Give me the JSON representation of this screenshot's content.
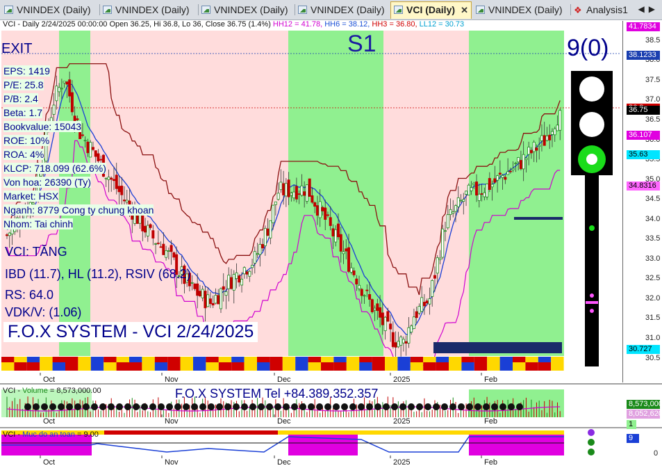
{
  "tabs": [
    {
      "label": "VNINDEX (Daily)",
      "active": false
    },
    {
      "label": "VNINDEX (Daily)",
      "active": false
    },
    {
      "label": "VNINDEX (Daily)",
      "active": false
    },
    {
      "label": "VNINDEX (Daily)",
      "active": false
    },
    {
      "label": "VCI (Daily)",
      "active": true,
      "close": "✕"
    },
    {
      "label": "VNINDEX (Daily)",
      "active": false
    },
    {
      "label": "Analysis1",
      "active": false
    }
  ],
  "header": {
    "main": "VCI - Daily 2/24/2025 00:00:00 Open 36.25, Hi 36.8, Lo 36, Close 36.75 (1.4%)",
    "hh12": "HH12 = 41.78,",
    "hh6": "HH6 = 38.12,",
    "hh3": "HH3 = 36.80,",
    "ll12": "LL12 = 30.73"
  },
  "signals": {
    "exit": "EXIT",
    "phase": "S1",
    "score": "9(0)"
  },
  "fundamentals": [
    "EPS: 1419",
    "P/E: 25.8",
    "P/B: 2.4",
    "Beta: 1.7",
    "Bookvalue: 15043",
    "ROE: 10%",
    "ROA: 4%",
    "KLCP: 718.099 (62.6%)",
    "Von hoa: 26390 (Ty)",
    "Market: HSX",
    "Nganh: 8779 Cong ty chung khoan",
    "Nhom: Tai chinh"
  ],
  "assessment": {
    "trend": "VCI: TĂNG",
    "ratings": "IBD (11.7), HL (11.2), RSIV (68.2)",
    "rs": "RS: 64.0",
    "vdk": "VDK/V:  (1.06)"
  },
  "system_title": "F.O.X SYSTEM - VCI 2/24/2025",
  "system_phone": "F.O.X SYSTEM Tel +84.389.352.357",
  "price_axis": {
    "ticks": [
      "38.5",
      "38.0",
      "37.5",
      "37.0",
      "36.5",
      "36.0",
      "35.5",
      "35.0",
      "34.5",
      "34.0",
      "33.5",
      "33.0",
      "32.5",
      "32.0",
      "31.5",
      "31.0",
      "30.5"
    ],
    "tags": [
      {
        "text": "41.7834",
        "bg": "#e000e0",
        "fg": "#ffffff",
        "value": 41.7834
      },
      {
        "text": "38.1233",
        "bg": "#1a3fb0",
        "fg": "#ffffff",
        "value": 38.1233
      },
      {
        "text": "36.8",
        "bg": "#d00000",
        "fg": "#ffffff",
        "value": 36.8
      },
      {
        "text": "36.75",
        "bg": "#000000",
        "fg": "#ffffff",
        "value": 36.75
      },
      {
        "text": "36.107",
        "bg": "#e000e0",
        "fg": "#ffffff",
        "value": 36.107
      },
      {
        "text": "35.63",
        "bg": "#00e5ff",
        "fg": "#000000",
        "value": 35.63
      },
      {
        "text": "34.8316",
        "bg": "#ff66ff",
        "fg": "#000000",
        "value": 34.8316
      },
      {
        "text": "30.727",
        "bg": "#00e5ff",
        "fg": "#000000",
        "value": 30.727
      }
    ]
  },
  "months": [
    "Oct",
    "Nov",
    "Dec",
    "2025",
    "Feb"
  ],
  "volume": {
    "label_prefix": "VCI - ",
    "label_name": "Volume",
    "label_value": " = 8,573,000.00",
    "tag1": "8,573,000",
    "tag2": "8,052,620",
    "tag3": "1"
  },
  "safety": {
    "label_prefix": "VCI - ",
    "label_name": "Muc do an toan",
    "label_value": " = 9.00",
    "tag": "9",
    "axis0": "0"
  },
  "colors": {
    "green_zone": "#90f090",
    "pink_zone": "#ffdcdc",
    "candle_up": "#1a8a1a",
    "candle_down": "#c00000",
    "hh_line": "#8b1010",
    "blue_line": "#1a3fd6",
    "magenta_line": "#d000d0",
    "cyan_fill": "#00e5ff"
  },
  "chart_data": {
    "type": "candlestick",
    "title": "VCI - Daily",
    "ylim": [
      30.3,
      38.9
    ],
    "last_close": 36.75
  }
}
